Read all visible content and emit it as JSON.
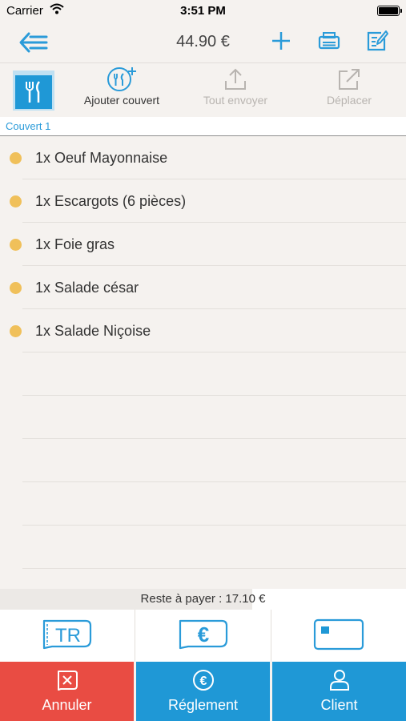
{
  "status_bar": {
    "carrier": "Carrier",
    "time": "3:51 PM"
  },
  "nav": {
    "total": "44.90 €",
    "accent": "#2a9bd9"
  },
  "toolbar": {
    "add_cover": "Ajouter couvert",
    "send_all": "Tout envoyer",
    "move": "Déplacer"
  },
  "section": {
    "title": "Couvert 1"
  },
  "items": [
    {
      "label": "1x Oeuf Mayonnaise",
      "status_color": "#f0c05a"
    },
    {
      "label": "1x Escargots (6 pièces)",
      "status_color": "#f0c05a"
    },
    {
      "label": "1x Foie gras",
      "status_color": "#f0c05a"
    },
    {
      "label": "1x Salade césar",
      "status_color": "#f0c05a"
    },
    {
      "label": "1x Salade Niçoise",
      "status_color": "#f0c05a"
    }
  ],
  "remaining": "Reste à payer : 17.10 €",
  "payment_methods": [
    {
      "icon": "ticket-restaurant-icon",
      "text": "TR"
    },
    {
      "icon": "euro-note-icon"
    },
    {
      "icon": "card-icon"
    }
  ],
  "actions": {
    "cancel": "Annuler",
    "payment": "Réglement",
    "client": "Client",
    "cancel_color": "#e94c43",
    "primary_color": "#1f98d6"
  }
}
